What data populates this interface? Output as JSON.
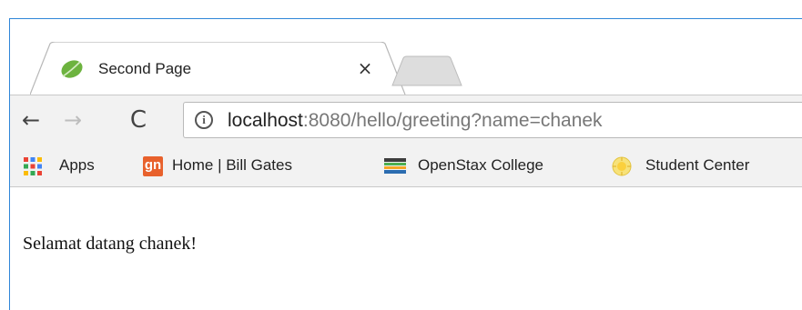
{
  "tab": {
    "title": "Second Page",
    "close_glyph": "×",
    "favicon": "spring-leaf-icon"
  },
  "toolbar": {
    "back_glyph": "←",
    "forward_glyph": "→",
    "reload_glyph": "C",
    "info_glyph": "i",
    "url_host": "localhost",
    "url_rest": ":8080/hello/greeting?name=chanek"
  },
  "bookmarks": {
    "items": [
      {
        "label": "Apps",
        "icon": "apps-grid-icon"
      },
      {
        "label": "Home | Bill Gates",
        "icon": "gn-icon",
        "icon_text": "gn"
      },
      {
        "label": "OpenStax College",
        "icon": "books-stack-icon"
      },
      {
        "label": "Student Center",
        "icon": "sun-seal-icon"
      }
    ]
  },
  "page": {
    "greeting": "Selamat datang chanek!"
  },
  "colors": {
    "frame_border": "#2f86d8",
    "toolbar_bg": "#f2f2f2",
    "favicon_green": "#6db33f",
    "gn_orange": "#e8612c"
  }
}
